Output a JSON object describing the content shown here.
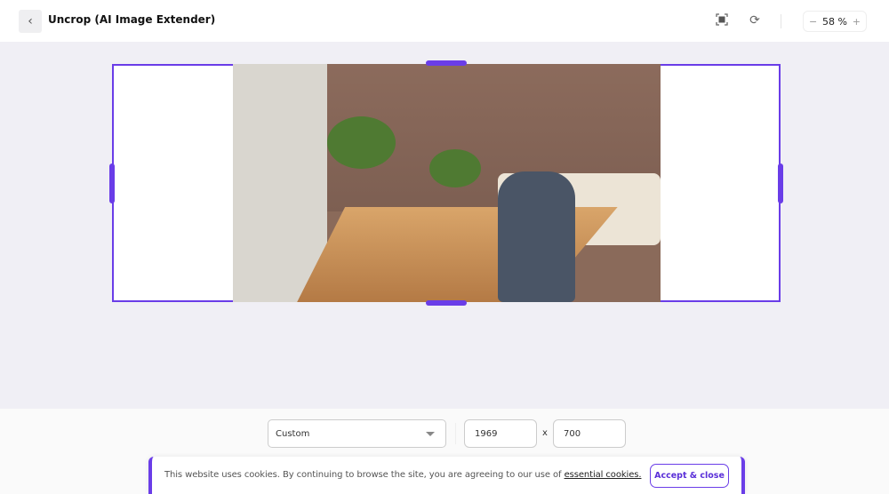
{
  "header": {
    "title": "Uncrop (AI Image Extender)",
    "zoom_value": "58 %",
    "zoom_minus": "−",
    "zoom_plus": "+"
  },
  "controls": {
    "preset": "Custom",
    "width": "1969",
    "height": "700",
    "times": "x"
  },
  "cookie": {
    "text": "This website uses cookies. By continuing to browse the site, you are agreeing to our use of ",
    "link": "essential cookies.",
    "accept": "Accept & close"
  },
  "colors": {
    "accent": "#6a3de8"
  }
}
